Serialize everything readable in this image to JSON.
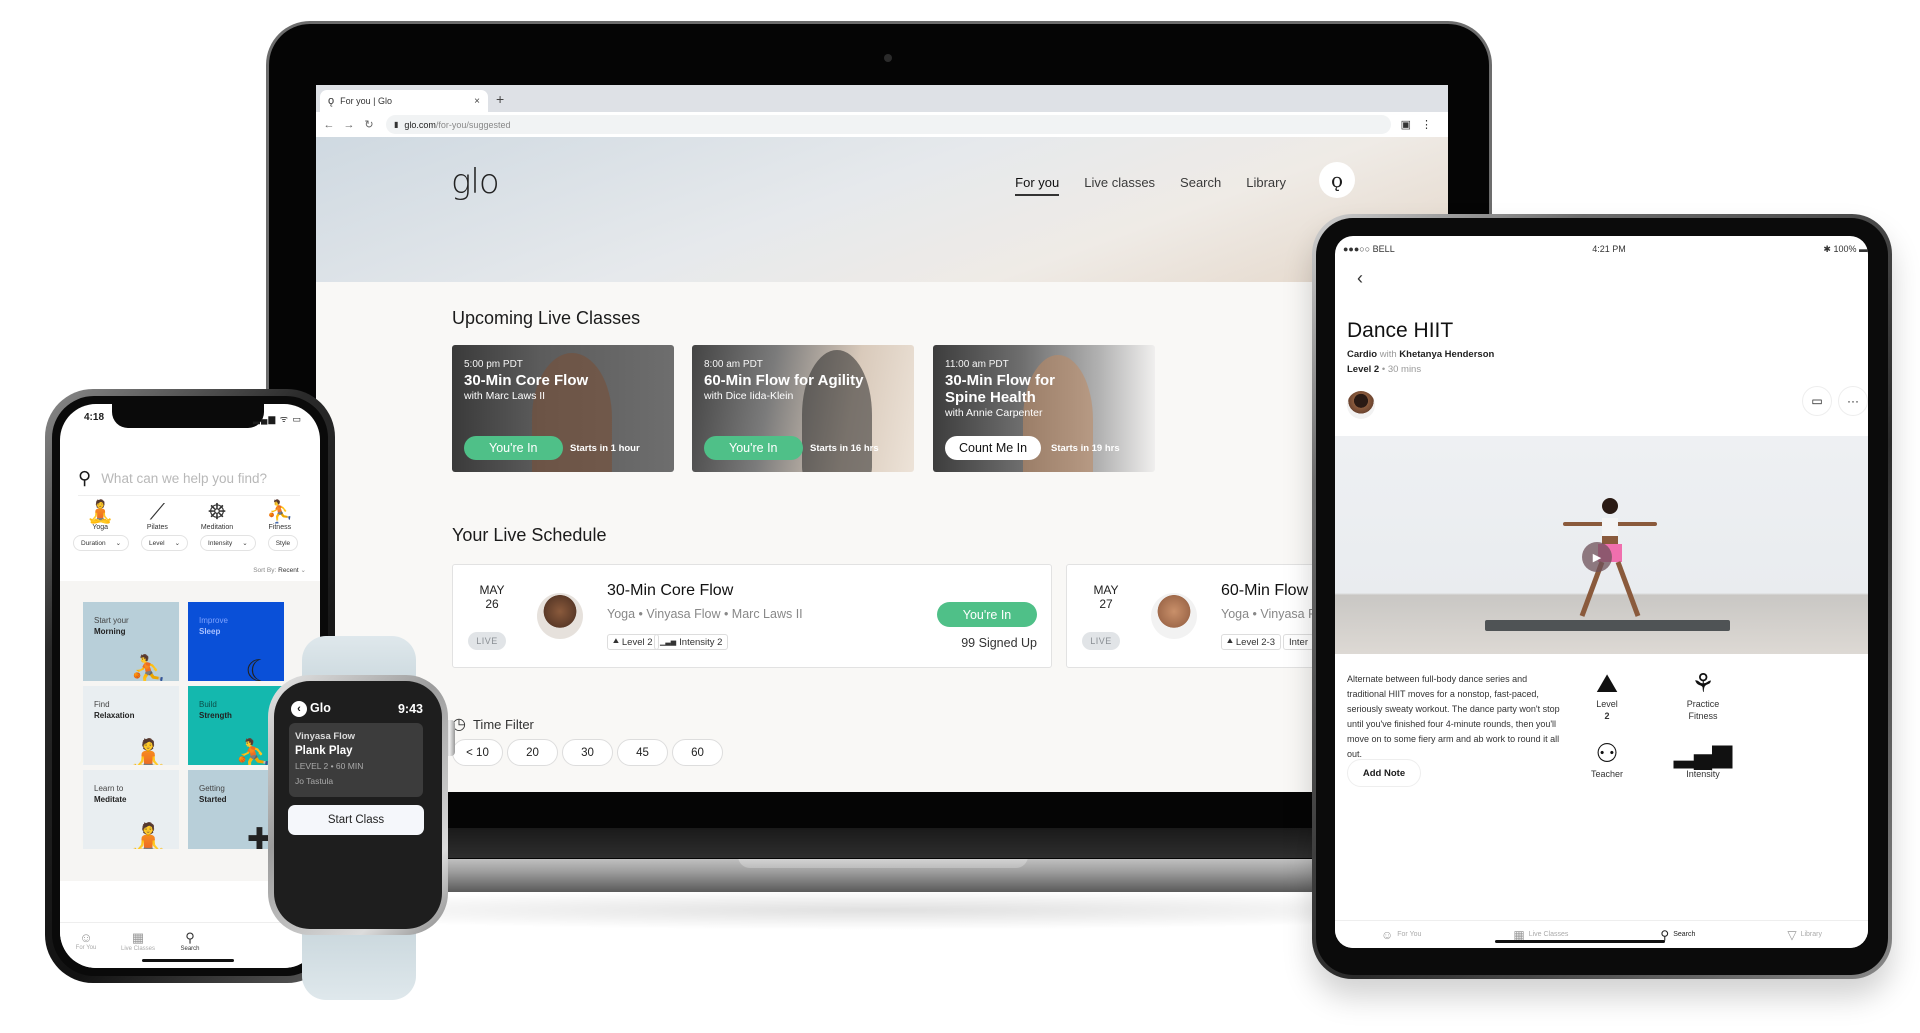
{
  "browser": {
    "tab_title": "For you | Glo",
    "tab_close": "×",
    "new_tab": "+",
    "url_host": "glo.com",
    "url_path": "/for-you/suggested",
    "nav_back": "←",
    "nav_forward": "→",
    "nav_reload": "↻",
    "lock_icon": "🔒",
    "menu_icon": "⋮"
  },
  "site": {
    "logo": "glo",
    "nav": [
      {
        "label": "For you",
        "active": true
      },
      {
        "label": "Live classes"
      },
      {
        "label": "Search"
      },
      {
        "label": "Library"
      }
    ],
    "profile_glyph": "ǫ",
    "upcoming_title": "Upcoming Live Classes",
    "upcoming": [
      {
        "time": "5:00 pm PDT",
        "title": "30-Min Core Flow",
        "teacher": "with Marc Laws II",
        "button": "You're In",
        "starts": "Starts in 1 hour",
        "registered": true
      },
      {
        "time": "8:00 am PDT",
        "title": "60-Min Flow for Agility",
        "teacher": "with Dice Iida-Klein",
        "button": "You're In",
        "starts": "Starts in 16 hrs",
        "registered": true
      },
      {
        "time": "11:00 am PDT",
        "title": "30-Min Flow for Spine Health",
        "teacher": "with Annie Carpenter",
        "button": "Count Me In",
        "starts": "Starts in 19 hrs",
        "registered": false
      }
    ],
    "schedule_title": "Your Live Schedule",
    "schedule": [
      {
        "month": "MAY",
        "day": "26",
        "badge": "LIVE",
        "title": "30-Min Core Flow",
        "meta": "Yoga • Vinyasa Flow • Marc Laws II",
        "tags": [
          "Level 2",
          "Intensity 2"
        ],
        "button": "You're In",
        "signed_up": "99 Signed Up"
      },
      {
        "month": "MAY",
        "day": "27",
        "badge": "LIVE",
        "title": "60-Min Flow",
        "meta": "Yoga • Vinyasa F",
        "tags": [
          "Level 2-3",
          "Inter"
        ]
      }
    ],
    "time_filter_label": "Time Filter",
    "time_filters": [
      "< 10",
      "20",
      "30",
      "45",
      "60"
    ],
    "accent_green": "#4fc088"
  },
  "phone": {
    "time": "4:18",
    "status_icons": "▂▄▆ ᯤ ▭",
    "search_placeholder": "What can we help you find?",
    "categories": [
      "Yoga",
      "Pilates",
      "Meditation",
      "Fitness"
    ],
    "filters": [
      "Duration",
      "Level",
      "Intensity",
      "Style"
    ],
    "sort_label": "Sort By:",
    "sort_value": "Recent",
    "tiles": [
      {
        "line1": "Start your",
        "line2": "Morning",
        "color": "#b8cfd9"
      },
      {
        "line1": "Improve",
        "line2": "Sleep",
        "color": "#0a50d8"
      },
      {
        "line1": "Find",
        "line2": "Relaxation",
        "color": "#e9eef1"
      },
      {
        "line1": "Build",
        "line2": "Strength",
        "color": "#14b8ae"
      },
      {
        "line1": "Learn to",
        "line2": "Meditate",
        "color": "#e9eef1"
      },
      {
        "line1": "Getting",
        "line2": "Started",
        "color": "#b8cfd9"
      }
    ],
    "tabs": [
      {
        "label": "For You"
      },
      {
        "label": "Live Classes"
      },
      {
        "label": "Search",
        "active": true
      }
    ]
  },
  "watch": {
    "app": "Glo",
    "time": "9:43",
    "category": "Vinyasa Flow",
    "title": "Plank Play",
    "details": "LEVEL 2 • 60 MIN",
    "teacher": "Jo Tastula",
    "button": "Start Class"
  },
  "tablet": {
    "carrier": "●●●○○ BELL",
    "time": "4:21 PM",
    "battery": "100%",
    "title": "Dance HIIT",
    "category": "Cardio",
    "with": "with",
    "teacher": "Khetanya Henderson",
    "level": "Level 2",
    "duration": "• 30 mins",
    "description": "Alternate between full-body dance series and traditional HIIT moves for a nonstop, fast-paced, seriously sweaty workout. The dance party won't stop until you've finished four 4-minute rounds, then you'll move on to some fiery arm and ab work to round it all out.",
    "add_note": "Add Note",
    "attributes": [
      {
        "label": "Level",
        "value": "2"
      },
      {
        "label": "Practice",
        "value": "Fitness"
      },
      {
        "label": "Teacher",
        "value": ""
      },
      {
        "label": "Intensity",
        "value": ""
      }
    ],
    "tabs": [
      {
        "label": "For You"
      },
      {
        "label": "Live Classes"
      },
      {
        "label": "Search",
        "active": true
      },
      {
        "label": "Library"
      }
    ]
  }
}
